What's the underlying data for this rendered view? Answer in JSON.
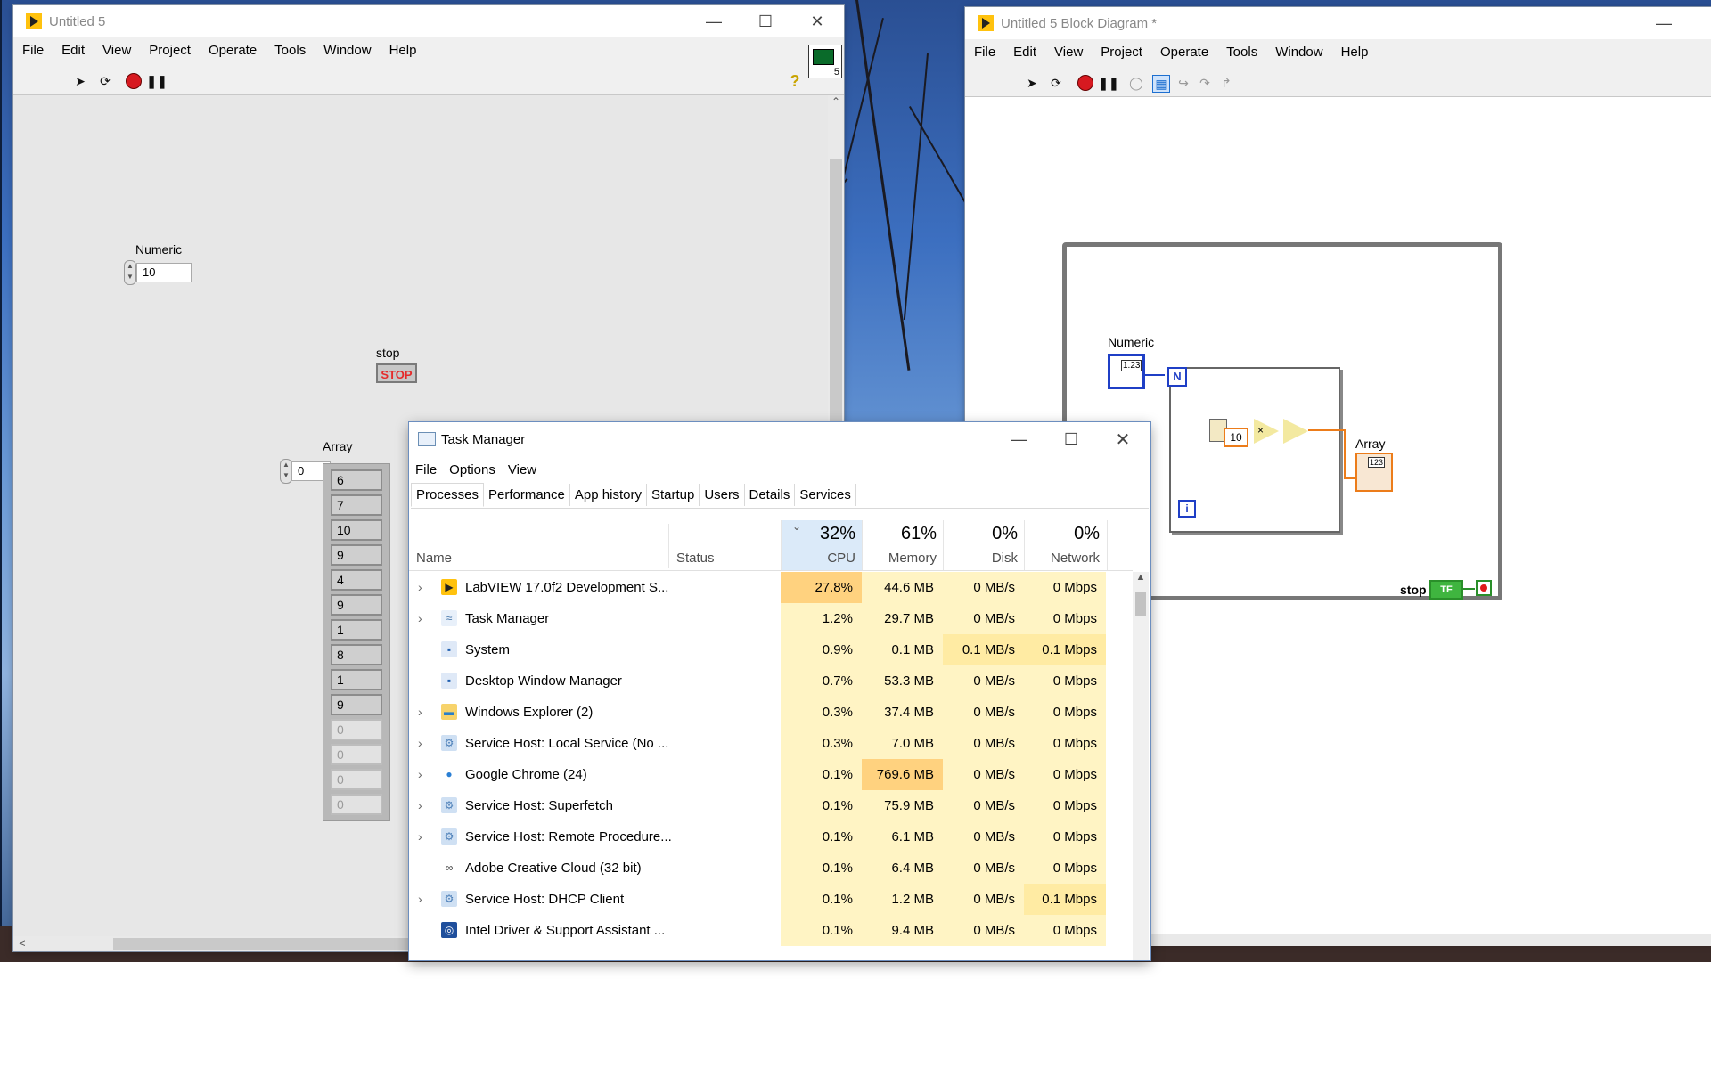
{
  "front_panel": {
    "title": "Untitled 5",
    "menu": [
      "File",
      "Edit",
      "View",
      "Project",
      "Operate",
      "Tools",
      "Window",
      "Help"
    ],
    "numeric_label": "Numeric",
    "numeric_value": "10",
    "stop_label": "stop",
    "stop_button": "STOP",
    "array_label": "Array",
    "array_index": "0",
    "array_values": [
      "6",
      "7",
      "10",
      "9",
      "4",
      "9",
      "1",
      "8",
      "1",
      "9",
      "0",
      "0",
      "0",
      "0"
    ],
    "icon_number": "5"
  },
  "block_diagram": {
    "title": "Untitled 5 Block Diagram *",
    "menu": [
      "File",
      "Edit",
      "View",
      "Project",
      "Operate",
      "Tools",
      "Window",
      "Help"
    ],
    "numeric_label": "Numeric",
    "numeric_terminal": "1.23",
    "loop_count": "N",
    "loop_index": "i",
    "constant": "10",
    "array_label": "Array",
    "array_terminal": "123",
    "stop_label": "stop",
    "stop_terminal": "TF",
    "multiply": "×"
  },
  "task_manager": {
    "title": "Task Manager",
    "menu": [
      "File",
      "Options",
      "View"
    ],
    "tabs": [
      "Processes",
      "Performance",
      "App history",
      "Startup",
      "Users",
      "Details",
      "Services"
    ],
    "columns": {
      "name": "Name",
      "status": "Status",
      "cpu_pct": "32%",
      "cpu": "CPU",
      "mem_pct": "61%",
      "mem": "Memory",
      "disk_pct": "0%",
      "disk": "Disk",
      "net_pct": "0%",
      "net": "Network"
    },
    "rows": [
      {
        "name": "LabVIEW 17.0f2 Development S...",
        "cpu": "27.8%",
        "mem": "44.6 MB",
        "disk": "0 MB/s",
        "net": "0 Mbps",
        "expand": true,
        "icon": "labview-icon"
      },
      {
        "name": "Task Manager",
        "cpu": "1.2%",
        "mem": "29.7 MB",
        "disk": "0 MB/s",
        "net": "0 Mbps",
        "expand": true,
        "icon": "task-manager-icon"
      },
      {
        "name": "System",
        "cpu": "0.9%",
        "mem": "0.1 MB",
        "disk": "0.1 MB/s",
        "net": "0.1 Mbps",
        "expand": false,
        "icon": "system-icon"
      },
      {
        "name": "Desktop Window Manager",
        "cpu": "0.7%",
        "mem": "53.3 MB",
        "disk": "0 MB/s",
        "net": "0 Mbps",
        "expand": false,
        "icon": "window-icon"
      },
      {
        "name": "Windows Explorer (2)",
        "cpu": "0.3%",
        "mem": "37.4 MB",
        "disk": "0 MB/s",
        "net": "0 Mbps",
        "expand": true,
        "icon": "folder-icon"
      },
      {
        "name": "Service Host: Local Service (No ...",
        "cpu": "0.3%",
        "mem": "7.0 MB",
        "disk": "0 MB/s",
        "net": "0 Mbps",
        "expand": true,
        "icon": "gear-icon"
      },
      {
        "name": "Google Chrome (24)",
        "cpu": "0.1%",
        "mem": "769.6 MB",
        "disk": "0 MB/s",
        "net": "0 Mbps",
        "expand": true,
        "icon": "chrome-icon"
      },
      {
        "name": "Service Host: Superfetch",
        "cpu": "0.1%",
        "mem": "75.9 MB",
        "disk": "0 MB/s",
        "net": "0 Mbps",
        "expand": true,
        "icon": "gear-icon"
      },
      {
        "name": "Service Host: Remote Procedure...",
        "cpu": "0.1%",
        "mem": "6.1 MB",
        "disk": "0 MB/s",
        "net": "0 Mbps",
        "expand": true,
        "icon": "gear-icon"
      },
      {
        "name": "Adobe Creative Cloud (32 bit)",
        "cpu": "0.1%",
        "mem": "6.4 MB",
        "disk": "0 MB/s",
        "net": "0 Mbps",
        "expand": false,
        "icon": "creative-cloud-icon"
      },
      {
        "name": "Service Host: DHCP Client",
        "cpu": "0.1%",
        "mem": "1.2 MB",
        "disk": "0 MB/s",
        "net": "0.1 Mbps",
        "expand": true,
        "icon": "gear-icon"
      },
      {
        "name": "Intel Driver & Support Assistant ...",
        "cpu": "0.1%",
        "mem": "9.4 MB",
        "disk": "0 MB/s",
        "net": "0 Mbps",
        "expand": false,
        "icon": "intel-icon"
      }
    ],
    "colors": {
      "cpu_hot": "#ffd27f",
      "cell": "#fff4c4",
      "cell_mid": "#ffeba3",
      "mem_hot": "#ffd27f"
    }
  }
}
